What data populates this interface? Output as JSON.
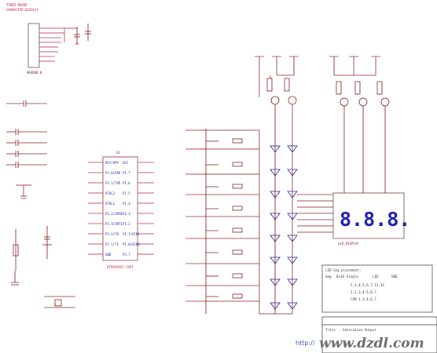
{
  "header": {
    "line1": "TIMER BOARD",
    "line2": "CHARACTER DISPLAY"
  },
  "connector": {
    "ref": "HEADER 8"
  },
  "mcu": {
    "ref": "U1",
    "part": "AT89S2051-24PI",
    "left_pins": [
      "RST/VPP",
      "P3.0/RXD",
      "P3.1/TXD",
      "XTAL2",
      "XTAL1",
      "P3.2/INT0",
      "P3.3/INT1",
      "P3.4/T0",
      "P3.5/T1",
      "GND"
    ],
    "right_pins": [
      "VCC",
      "P1.7",
      "P1.6",
      "P1.5",
      "P1.4",
      "P1.3",
      "P1.2",
      "P1.1/AIN1",
      "P1.0/AIN0",
      "P3.7"
    ]
  },
  "display": {
    "ref": "LED_DISPLAY",
    "digits": "8.8.8."
  },
  "notes": {
    "title": "LED Seg placement:",
    "lines": [
      "LED",
      "Seg",
      "8x16 Single",
      "P1",
      "1-6,8",
      "GND",
      "2,3,4,5,6,7,13,16",
      "1,2,3,4,5,6,7",
      "COM 1,3,4,6,7"
    ]
  },
  "title_block": {
    "title_label": "Title",
    "title": "Saturation Output"
  },
  "watermark": {
    "text": "www.dzdl.com",
    "site_prefix": "http://"
  },
  "colors": {
    "wire": "#8b1a1a",
    "net": "#c0203c",
    "part": "#1a1a90"
  }
}
